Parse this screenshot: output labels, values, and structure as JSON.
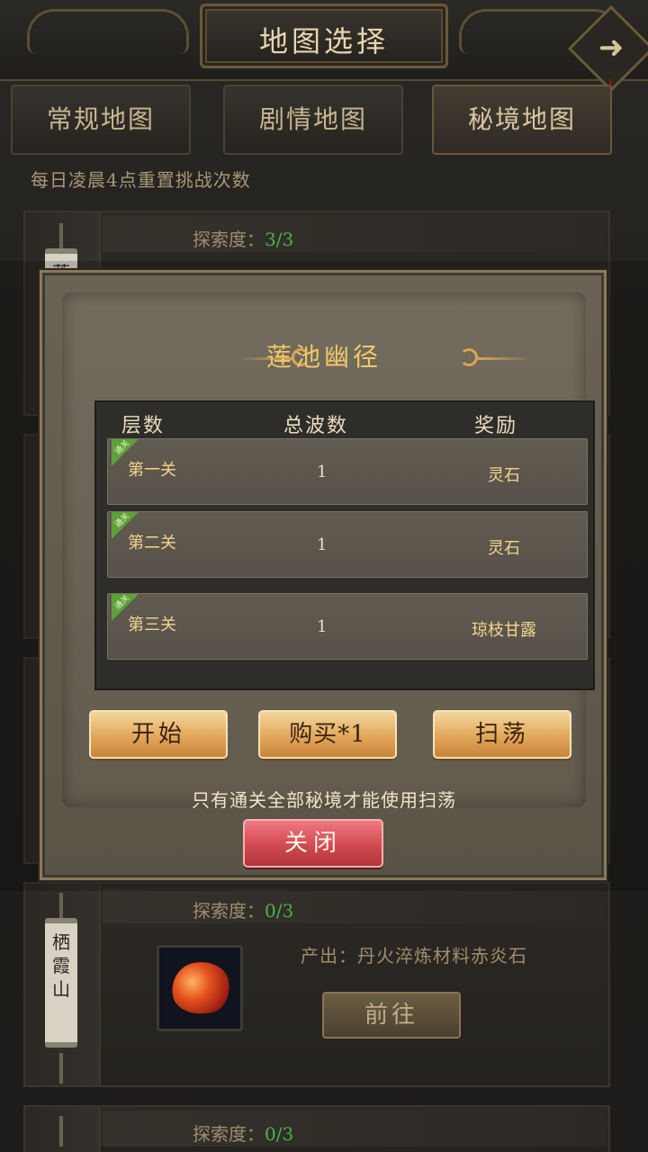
{
  "header": {
    "title": "地图选择",
    "next_icon": "arrow-right-icon"
  },
  "tabs": [
    {
      "label": "常规地图"
    },
    {
      "label": "剧情地图"
    },
    {
      "label": "秘境地图",
      "active": true
    }
  ],
  "notice": "每日凌晨4点重置挑战次数",
  "cards": [
    {
      "explore_label": "探索度：",
      "explore_value": "3/3",
      "scroll_text": "莲"
    },
    {
      "explore_label": "探索度：",
      "explore_value": "0/3",
      "scroll_text": "栖霞山",
      "produce": "产出：丹火淬炼材料赤炎石",
      "goto_label": "前往"
    },
    {
      "explore_label": "探索度：",
      "explore_value": "0/3"
    }
  ],
  "dialog": {
    "title": "莲池幽径",
    "columns": {
      "level": "层数",
      "waves": "总波数",
      "reward": "奖励"
    },
    "rows": [
      {
        "tag": "通关",
        "name": "第一关",
        "waves": "1",
        "reward": "灵石"
      },
      {
        "tag": "通关",
        "name": "第二关",
        "waves": "1",
        "reward": "灵石"
      },
      {
        "tag": "通关",
        "name": "第三关",
        "waves": "1",
        "reward": "琼枝甘露"
      }
    ],
    "buttons": {
      "start": "开始",
      "buy": "购买*1",
      "sweep": "扫荡"
    },
    "tip": "只有通关全部秘境才能使用扫荡",
    "close": "关闭"
  },
  "colors": {
    "explore_value": "#4fb14b",
    "title": "#f1c96a",
    "close": "#d14a50",
    "start": "#e2a75a"
  }
}
